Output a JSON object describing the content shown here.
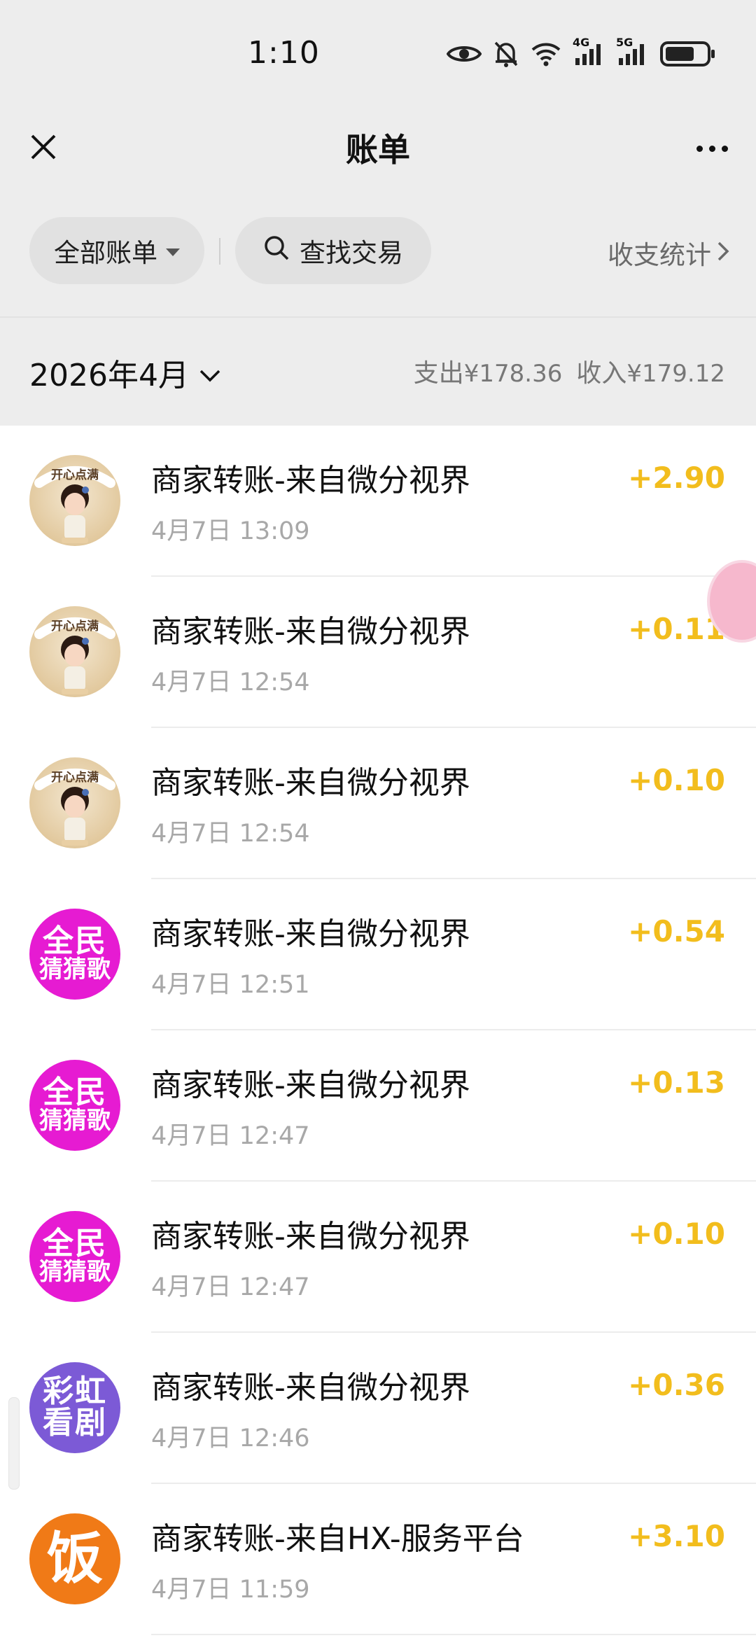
{
  "status_bar": {
    "time": "1:10",
    "net_4g": "4G",
    "net_5g": "5G"
  },
  "header": {
    "title": "账单"
  },
  "filters": {
    "all_bills_label": "全部账单",
    "search_label": "查找交易",
    "stats_label": "收支统计"
  },
  "month_bar": {
    "month_label": "2026年4月",
    "expense_label": "支出",
    "expense_amount": "¥178.36",
    "income_label": "收入",
    "income_amount": "¥179.12"
  },
  "transactions": [
    {
      "title": "商家转账-来自微分视界",
      "time": "4月7日 13:09",
      "amount": "+2.90",
      "avatar": "happy-icon",
      "avatar_text": "开心点满"
    },
    {
      "title": "商家转账-来自微分视界",
      "time": "4月7日 12:54",
      "amount": "+0.11",
      "avatar": "happy-icon",
      "avatar_text": "开心点满"
    },
    {
      "title": "商家转账-来自微分视界",
      "time": "4月7日 12:54",
      "amount": "+0.10",
      "avatar": "happy-icon",
      "avatar_text": "开心点满"
    },
    {
      "title": "商家转账-来自微分视界",
      "time": "4月7日 12:51",
      "amount": "+0.54",
      "avatar": "song-guess-icon",
      "avatar_line1": "全民",
      "avatar_line2": "猜猜歌"
    },
    {
      "title": "商家转账-来自微分视界",
      "time": "4月7日 12:47",
      "amount": "+0.13",
      "avatar": "song-guess-icon",
      "avatar_line1": "全民",
      "avatar_line2": "猜猜歌"
    },
    {
      "title": "商家转账-来自微分视界",
      "time": "4月7日 12:47",
      "amount": "+0.10",
      "avatar": "song-guess-icon",
      "avatar_line1": "全民",
      "avatar_line2": "猜猜歌"
    },
    {
      "title": "商家转账-来自微分视界",
      "time": "4月7日 12:46",
      "amount": "+0.36",
      "avatar": "rainbow-drama-icon",
      "avatar_line1": "彩虹",
      "avatar_line2": "看剧"
    },
    {
      "title": "商家转账-来自HX-服务平台",
      "time": "4月7日 11:59",
      "amount": "+3.10",
      "avatar": "fan-icon",
      "avatar_char": "饭"
    }
  ],
  "colors": {
    "income_amount": "#f2bd1d",
    "header_bg": "#ededed",
    "avatar_magenta": "#e61bd2",
    "avatar_purple": "#7c5ad6",
    "avatar_orange": "#f07a17"
  }
}
